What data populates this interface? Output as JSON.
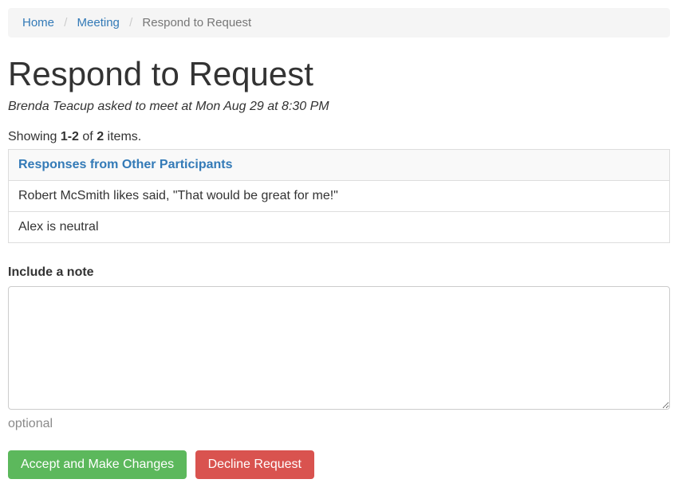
{
  "breadcrumb": {
    "home": "Home",
    "meeting": "Meeting",
    "current": "Respond to Request"
  },
  "page": {
    "title": "Respond to Request",
    "subtitle": "Brenda Teacup asked to meet at Mon Aug 29 at 8:30 PM"
  },
  "summary": {
    "prefix": "Showing ",
    "range": "1-2",
    "middle": " of ",
    "total": "2",
    "suffix": " items."
  },
  "table": {
    "header": "Responses from Other Participants",
    "rows": [
      "Robert McSmith likes said, \"That would be great for me!\"",
      "Alex is neutral"
    ]
  },
  "note": {
    "label": "Include a note",
    "value": "",
    "hint": "optional"
  },
  "buttons": {
    "accept": "Accept and Make Changes",
    "decline": "Decline Request"
  }
}
